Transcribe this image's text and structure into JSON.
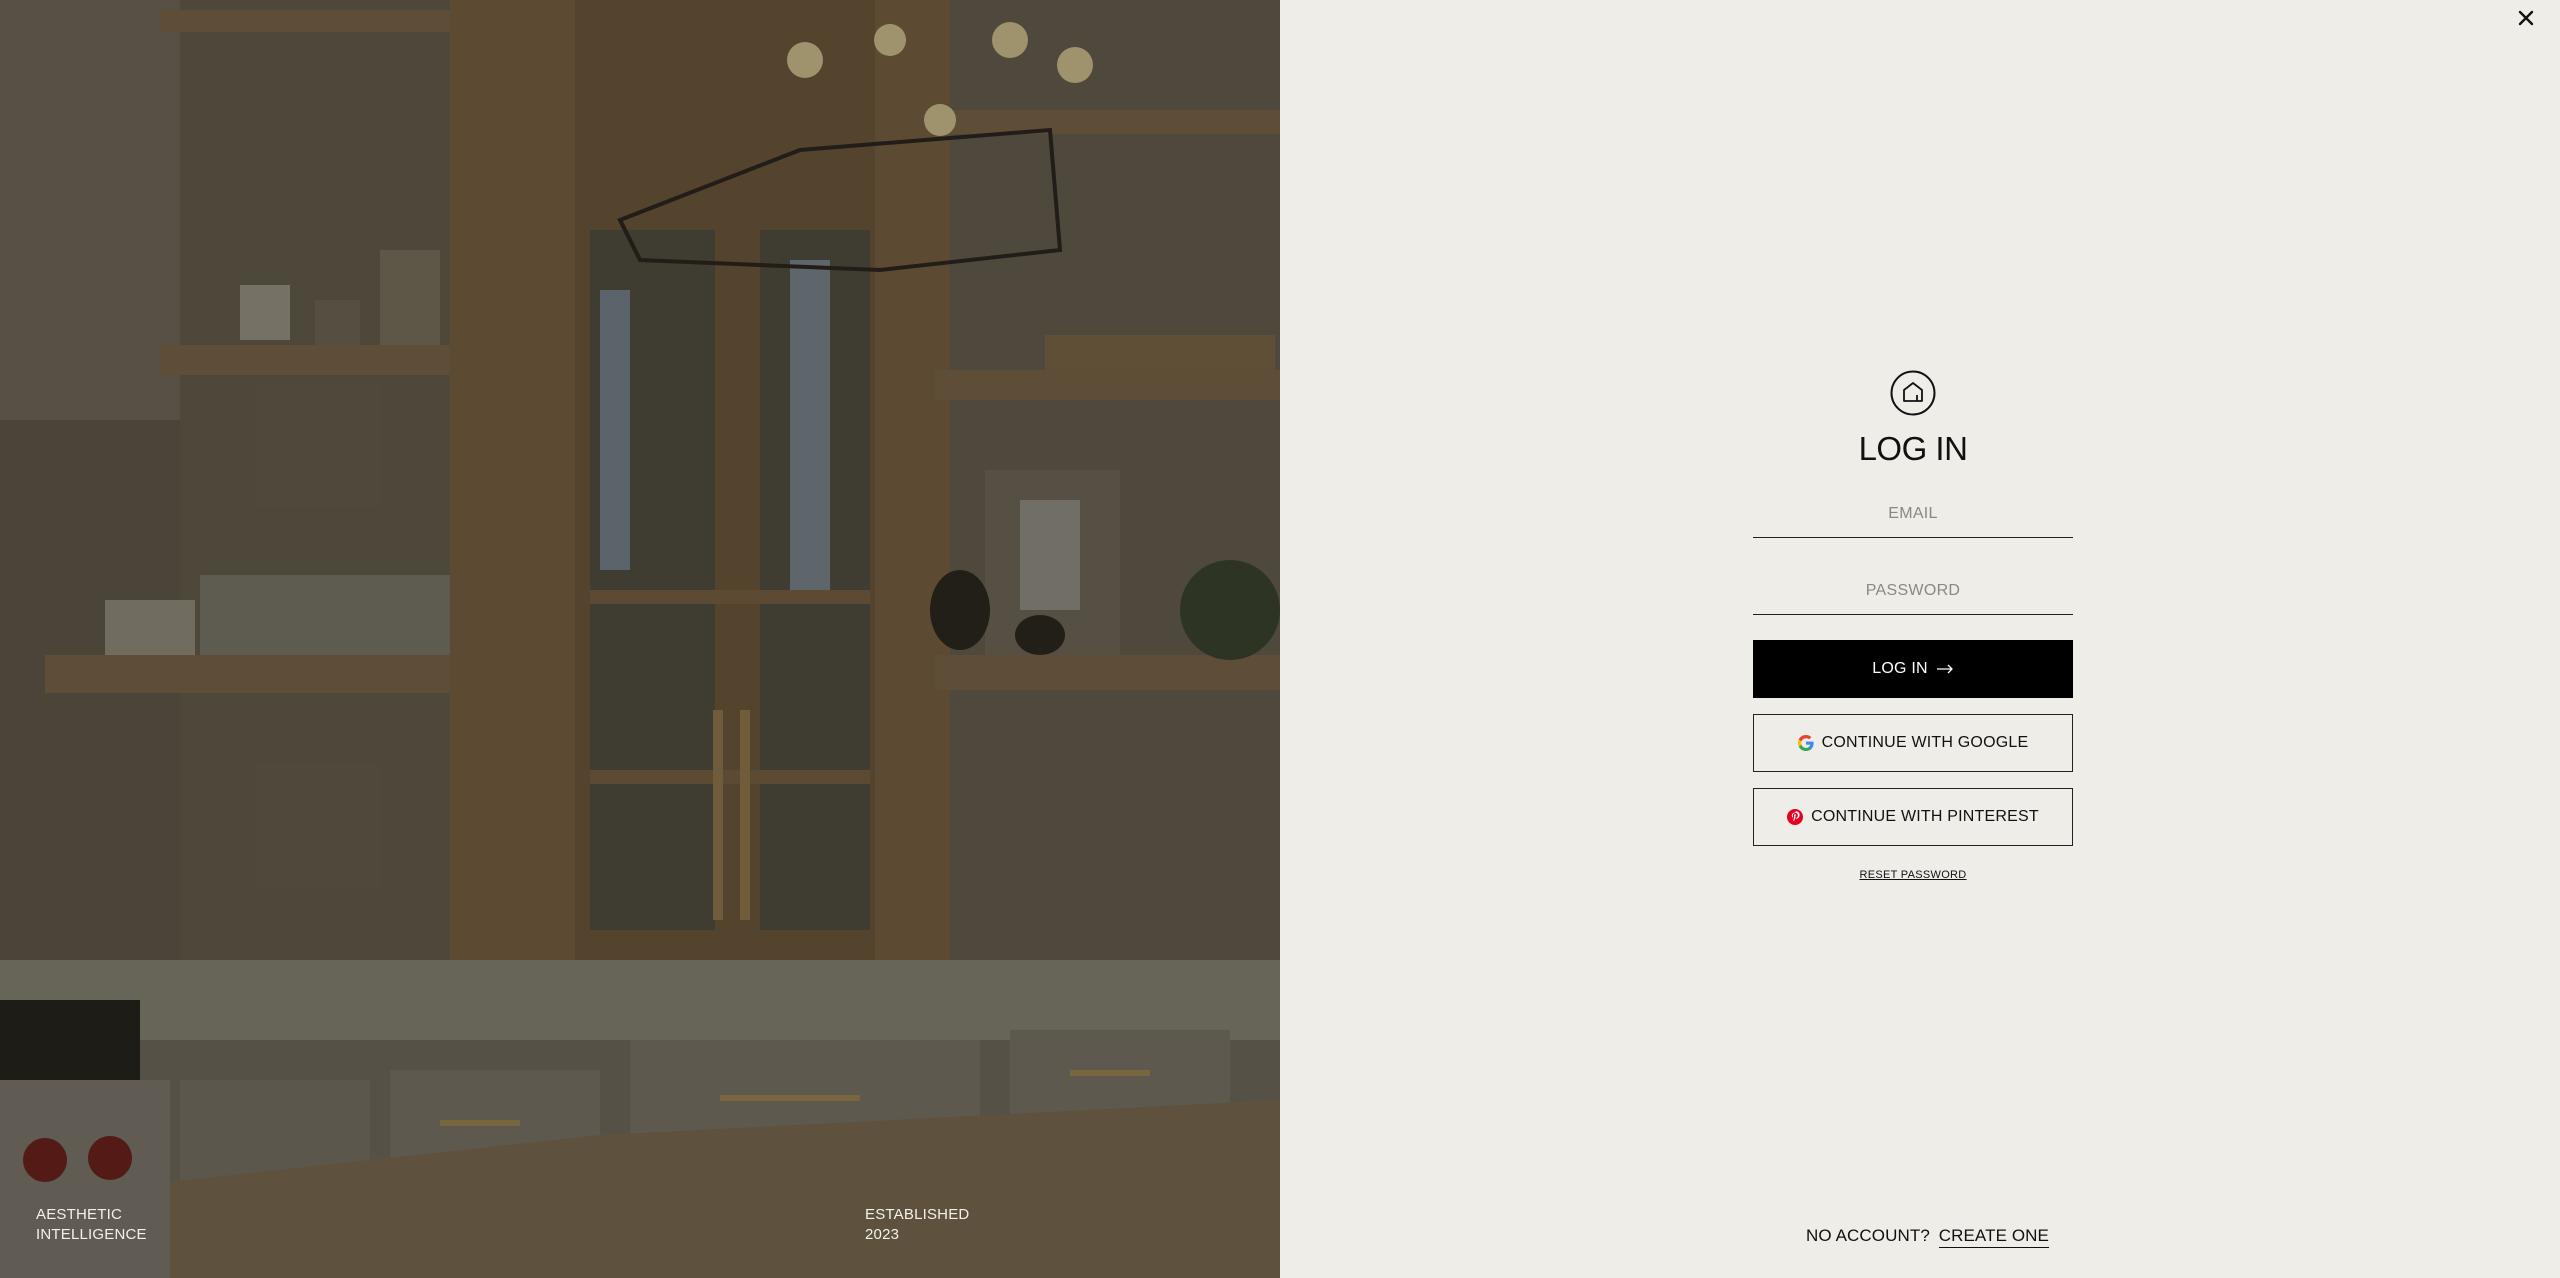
{
  "photo": {
    "caption_left_line1": "AESTHETIC",
    "caption_left_line2": "INTELLIGENCE",
    "caption_right_line1": "ESTABLISHED",
    "caption_right_line2": "2023"
  },
  "header": {
    "close_icon": "close-icon"
  },
  "login": {
    "logo_icon": "house-icon",
    "title": "LOG IN",
    "email_placeholder": "EMAIL",
    "password_placeholder": "PASSWORD",
    "login_button": "LOG IN",
    "google_button": "CONTINUE WITH GOOGLE",
    "pinterest_button": "CONTINUE WITH PINTEREST",
    "reset_link": "RESET PASSWORD"
  },
  "footer": {
    "no_account_text": "NO ACCOUNT?",
    "create_link": "CREATE ONE"
  },
  "colors": {
    "background": "#efede8",
    "primary": "#000000",
    "pinterest": "#e60023"
  }
}
